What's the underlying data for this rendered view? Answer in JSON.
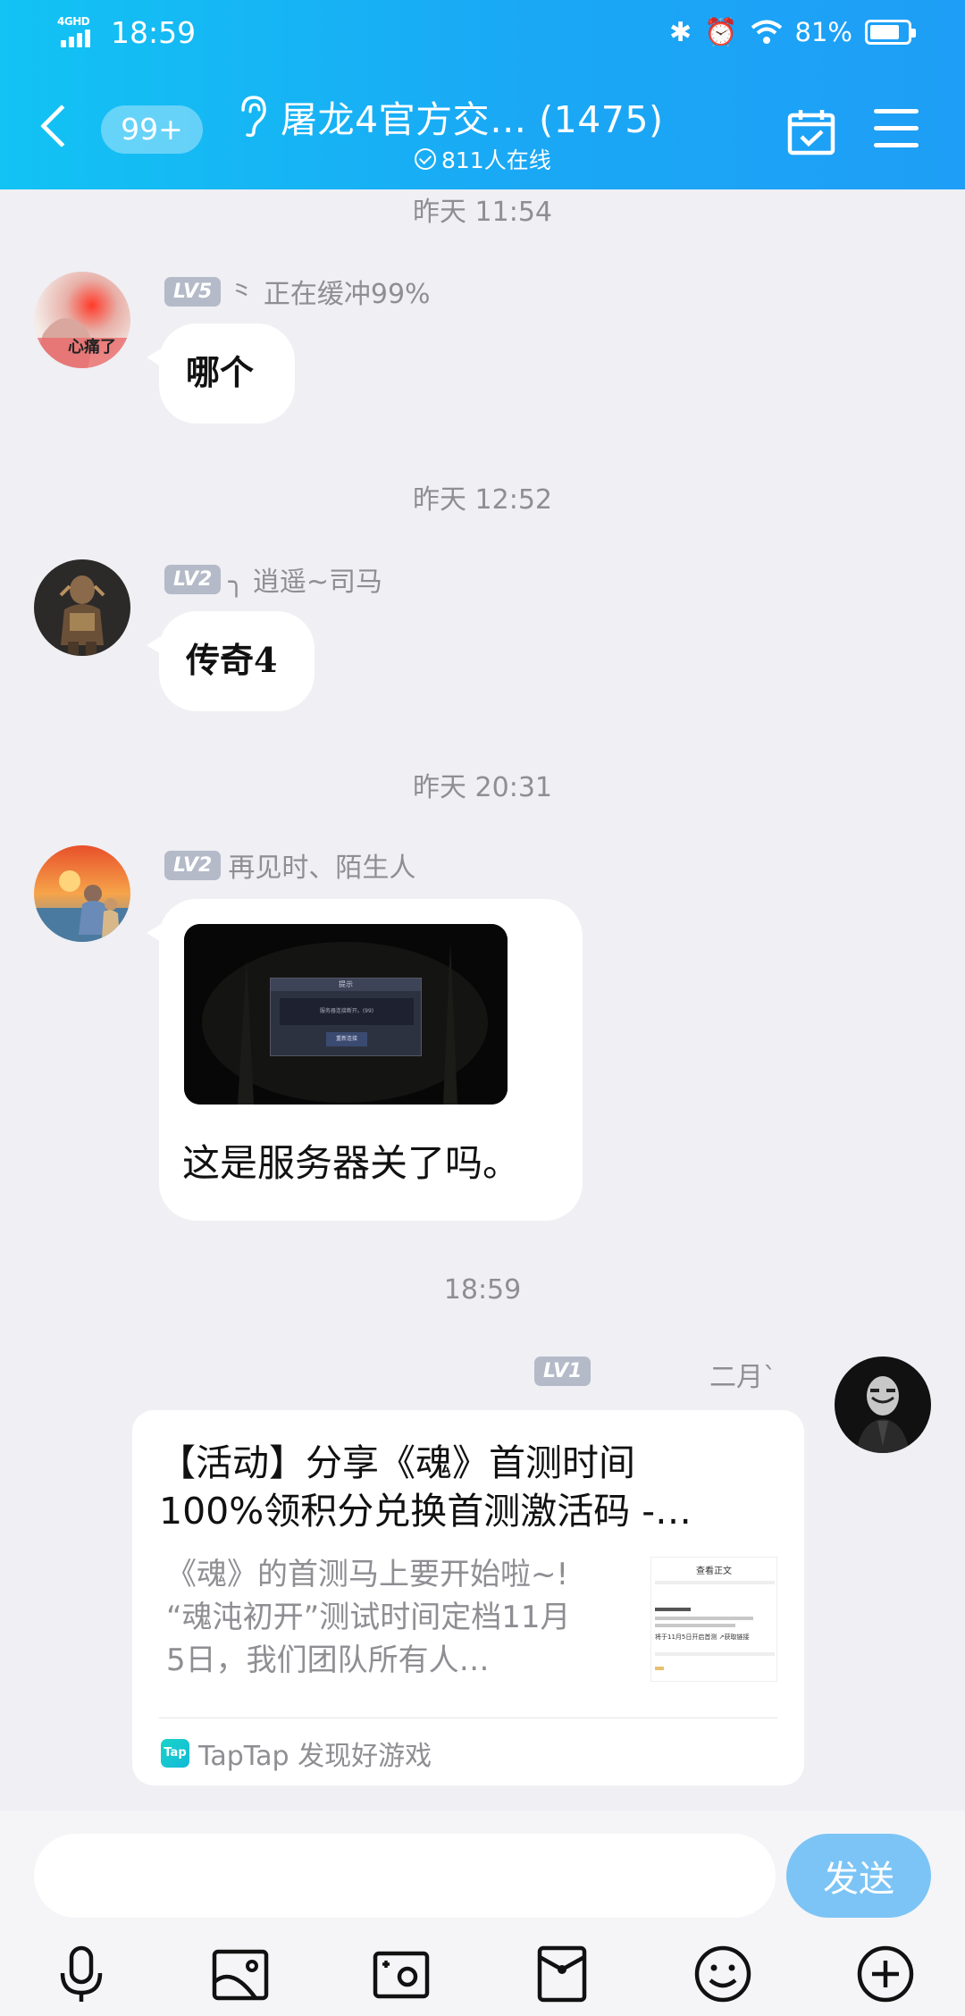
{
  "status_bar": {
    "network": "4GHD",
    "time": "18:59",
    "battery": "81%",
    "battery_level": 0.81
  },
  "header": {
    "unread_badge": "99+",
    "title": "屠龙4官方交… (1475)",
    "online": "811人在线"
  },
  "messages": [
    {
      "timestamp": "昨天 11:54",
      "level": "LV5",
      "sender": "⺀ 正在缓冲99%",
      "avatar_text": "心痛了",
      "text": "哪个"
    },
    {
      "timestamp": "昨天 12:52",
      "level": "LV2",
      "sender": "╮ 逍遥~司马",
      "text": "传奇4"
    },
    {
      "timestamp": "昨天 20:31",
      "level": "LV2",
      "sender": "再见时、陌生人",
      "image_dialog": {
        "title": "提示",
        "body": "服务器连接断开。(99)",
        "button": "重新连接"
      },
      "text": "这是服务器关了吗。"
    },
    {
      "timestamp": "18:59",
      "level": "LV1",
      "sender": "二月ˋ",
      "card": {
        "title_line1": "【活动】分享《魂》首测时间",
        "title_line2": "100%领积分兑换首测激活码 -…",
        "desc_line1": "《魂》的首测马上要开始啦~!",
        "desc_line2": "“魂沌初开”测试时间定档11月",
        "desc_line3": "5日，我们团队所有人…",
        "thumb_title": "查看正文",
        "thumb_row": "将于11月5日开启首测 ↗获取链接",
        "source_logo": "Tap",
        "source": "TapTap 发现好游戏"
      }
    }
  ],
  "composer": {
    "placeholder": "",
    "send_label": "发送"
  },
  "colors": {
    "header_start": "#12c3f4",
    "header_end": "#1e9ef6",
    "send_button": "#7cc4f6",
    "level_badge": "#b4bac8"
  }
}
